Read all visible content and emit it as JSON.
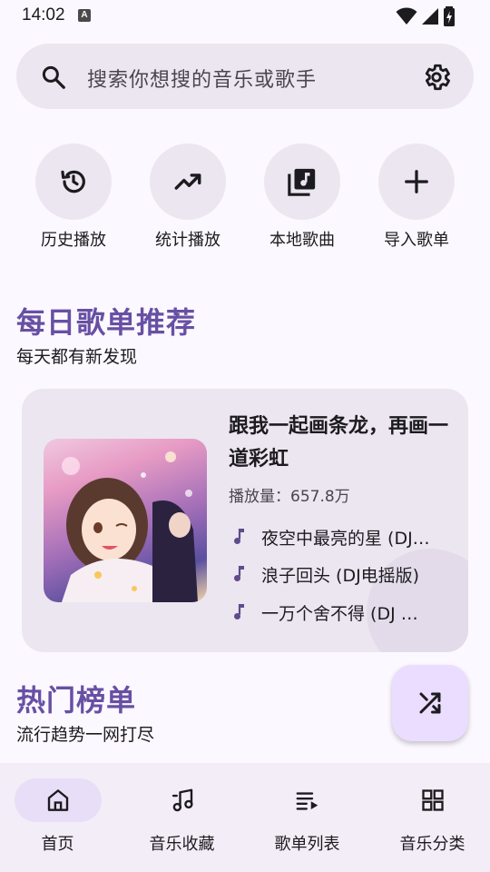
{
  "status_bar": {
    "time": "14:02",
    "notification_icon": "A"
  },
  "search": {
    "placeholder": "搜索你想搜的音乐或歌手"
  },
  "quick_actions": [
    {
      "label": "历史播放",
      "icon": "history-icon"
    },
    {
      "label": "统计播放",
      "icon": "trending-up-icon"
    },
    {
      "label": "本地歌曲",
      "icon": "library-music-icon"
    },
    {
      "label": "导入歌单",
      "icon": "add-icon"
    }
  ],
  "daily": {
    "title": "每日歌单推荐",
    "subtitle": "每天都有新发现",
    "playlist_title": "跟我一起画条龙，再画一道彩虹",
    "plays": "播放量：657.8万",
    "tracks": [
      "夜空中最亮的星 (DJ…",
      "浪子回头 (DJ电摇版)",
      "一万个舍不得 (DJ …"
    ]
  },
  "charts": {
    "title": "热门榜单",
    "subtitle": "流行趋势一网打尽"
  },
  "nav": [
    {
      "label": "首页",
      "icon": "home-icon",
      "active": true
    },
    {
      "label": "音乐收藏",
      "icon": "music-note-icon"
    },
    {
      "label": "歌单列表",
      "icon": "queue-music-icon"
    },
    {
      "label": "音乐分类",
      "icon": "grid-icon"
    }
  ],
  "colors": {
    "accent": "#6750a4",
    "surface": "#ece6f0",
    "background": "#fcf8ff",
    "fab": "#eaddff"
  }
}
